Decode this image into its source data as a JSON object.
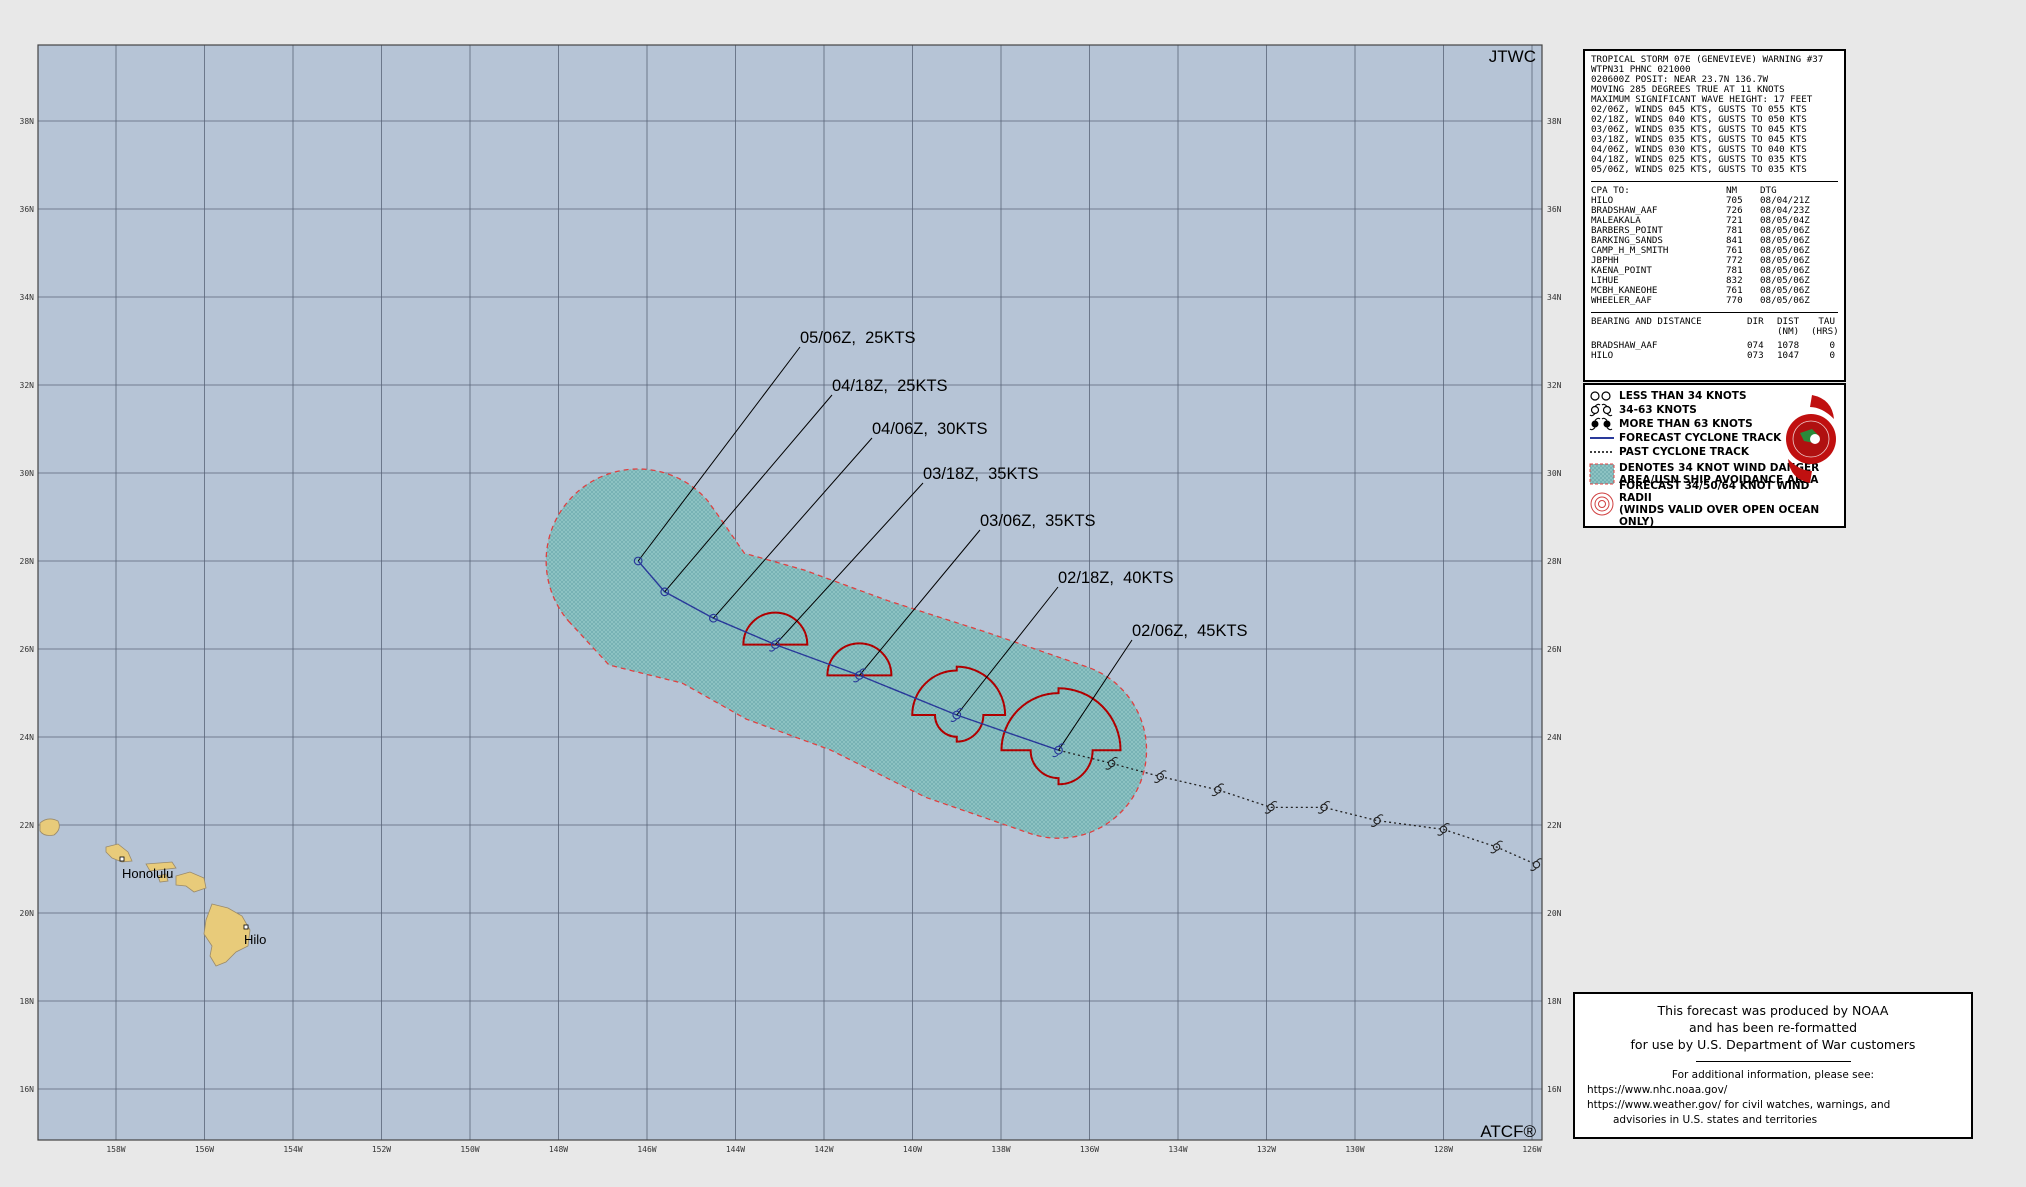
{
  "map": {
    "top_right_label": "JTWC",
    "bottom_right_label": "ATCF®",
    "lat_labels": [
      "16N",
      "18N",
      "20N",
      "22N",
      "24N",
      "26N",
      "28N",
      "30N",
      "32N",
      "34N",
      "36N",
      "38N"
    ],
    "lon_labels": [
      "158W",
      "156W",
      "154W",
      "152W",
      "150W",
      "148W",
      "146W",
      "144W",
      "142W",
      "140W",
      "138W",
      "136W",
      "134W",
      "132W",
      "130W",
      "128W",
      "126W"
    ],
    "cities": [
      {
        "name": "Honolulu",
        "lat": 21.3,
        "lon": 157.9
      },
      {
        "name": "Hilo",
        "lat": 19.7,
        "lon": 155.1
      }
    ],
    "forecast_track": [
      {
        "label": "05/06Z,  25KTS",
        "lat": 28.0,
        "lon": 146.2,
        "intensity_kt": 25
      },
      {
        "label": "04/18Z,  25KTS",
        "lat": 27.3,
        "lon": 145.6,
        "intensity_kt": 25
      },
      {
        "label": "04/06Z,  30KTS",
        "lat": 26.7,
        "lon": 144.5,
        "intensity_kt": 30
      },
      {
        "label": "03/18Z,  35KTS",
        "lat": 26.1,
        "lon": 143.1,
        "intensity_kt": 35
      },
      {
        "label": "03/06Z,  35KTS",
        "lat": 25.4,
        "lon": 141.2,
        "intensity_kt": 35
      },
      {
        "label": "02/18Z,  40KTS",
        "lat": 24.5,
        "lon": 139.0,
        "intensity_kt": 40
      },
      {
        "label": "02/06Z,  45KTS",
        "lat": 23.7,
        "lon": 136.7,
        "intensity_kt": 45
      }
    ],
    "past_track": [
      {
        "lat": 23.4,
        "lon": 135.5
      },
      {
        "lat": 23.1,
        "lon": 134.4
      },
      {
        "lat": 22.8,
        "lon": 133.1
      },
      {
        "lat": 22.4,
        "lon": 131.9
      },
      {
        "lat": 22.4,
        "lon": 130.7
      },
      {
        "lat": 22.1,
        "lon": 129.5
      },
      {
        "lat": 21.9,
        "lon": 128.0
      },
      {
        "lat": 21.5,
        "lon": 126.8
      },
      {
        "lat": 21.1,
        "lon": 125.9
      }
    ],
    "colors": {
      "ocean": "#b6c4d6",
      "grid": "#5a6578",
      "land": "#e8cb7a",
      "danger_area": "#8fc4c4",
      "danger_border": "#e04040",
      "wind_radii": "#b00000",
      "track": "#2a3a9a"
    }
  },
  "warning": {
    "lines": [
      "TROPICAL STORM 07E (GENEVIEVE) WARNING #37",
      "WTPN31 PHNC 021000",
      "020600Z POSIT: NEAR 23.7N 136.7W",
      "MOVING 285 DEGREES TRUE AT 11 KNOTS",
      "MAXIMUM SIGNIFICANT WAVE HEIGHT: 17 FEET",
      "02/06Z, WINDS 045 KTS, GUSTS TO 055 KTS",
      "02/18Z, WINDS 040 KTS, GUSTS TO 050 KTS",
      "03/06Z, WINDS 035 KTS, GUSTS TO 045 KTS",
      "03/18Z, WINDS 035 KTS, GUSTS TO 045 KTS",
      "04/06Z, WINDS 030 KTS, GUSTS TO 040 KTS",
      "04/18Z, WINDS 025 KTS, GUSTS TO 035 KTS",
      "05/06Z, WINDS 025 KTS, GUSTS TO 035 KTS"
    ],
    "cpa_header": {
      "name": "CPA TO:",
      "nm": "NM",
      "dtg": "DTG"
    },
    "cpa_rows": [
      {
        "name": "HILO",
        "nm": "705",
        "dtg": "08/04/21Z"
      },
      {
        "name": "BRADSHAW_AAF",
        "nm": "726",
        "dtg": "08/04/23Z"
      },
      {
        "name": "MALEAKALA",
        "nm": "721",
        "dtg": "08/05/04Z"
      },
      {
        "name": "BARBERS_POINT",
        "nm": "781",
        "dtg": "08/05/06Z"
      },
      {
        "name": "BARKING_SANDS",
        "nm": "841",
        "dtg": "08/05/06Z"
      },
      {
        "name": "CAMP_H_M_SMITH",
        "nm": "761",
        "dtg": "08/05/06Z"
      },
      {
        "name": "JBPHH",
        "nm": "772",
        "dtg": "08/05/06Z"
      },
      {
        "name": "KAENA_POINT",
        "nm": "781",
        "dtg": "08/05/06Z"
      },
      {
        "name": "LIHUE",
        "nm": "832",
        "dtg": "08/05/06Z"
      },
      {
        "name": "MCBH_KANEOHE",
        "nm": "761",
        "dtg": "08/05/06Z"
      },
      {
        "name": "WHEELER_AAF",
        "nm": "770",
        "dtg": "08/05/06Z"
      }
    ],
    "bearing_header": {
      "name": "BEARING AND DISTANCE",
      "dir": "DIR",
      "dist": "DIST",
      "tau": "TAU",
      "dist_unit": "(NM)",
      "tau_unit": "(HRS)"
    },
    "bearing_rows": [
      {
        "name": "BRADSHAW_AAF",
        "dir": "074",
        "dist": "1078",
        "tau": "0"
      },
      {
        "name": "HILO",
        "dir": "073",
        "dist": "1047",
        "tau": "0"
      }
    ]
  },
  "legend": {
    "items": [
      "LESS THAN 34 KNOTS",
      "34-63 KNOTS",
      "MORE THAN 63 KNOTS",
      "FORECAST CYCLONE TRACK",
      "PAST CYCLONE TRACK",
      "DENOTES 34 KNOT WIND DANGER",
      "AREA/USN SHIP AVOIDANCE AREA",
      "FORECAST 34/50/64 KNOT WIND RADII",
      "(WINDS VALID OVER OPEN OCEAN ONLY)"
    ]
  },
  "credit": {
    "main": [
      "This forecast was produced by NOAA",
      "and has been re-formatted",
      "for use by U.S. Department of War customers"
    ],
    "info_header": "For additional information, please see:",
    "link1": "https://www.nhc.noaa.gov/",
    "link2": "https://www.weather.gov/ for civil watches, warnings, and",
    "link3": "advisories in U.S. states and territories"
  }
}
